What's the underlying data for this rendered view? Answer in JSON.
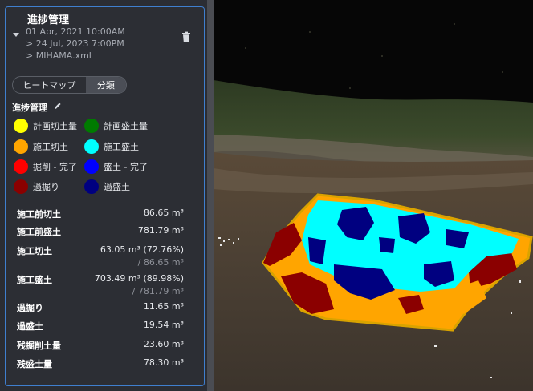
{
  "panel": {
    "title": "進捗管理",
    "meta_start": "01 Apr, 2021 10:00AM",
    "meta_end": "> 24 Jul, 2023 7:00PM",
    "meta_file": "> MIHAMA.xml",
    "collapse_icon": "chevron-down-icon",
    "delete_icon": "trash-icon"
  },
  "tabs": [
    {
      "label": "ヒートマップ",
      "active": false
    },
    {
      "label": "分類",
      "active": true
    }
  ],
  "legend": {
    "title": "進捗管理",
    "edit_icon": "pencil-icon",
    "items": [
      {
        "label": "計画切土量",
        "color": "#ffff00"
      },
      {
        "label": "計画盛土量",
        "color": "#007a00"
      },
      {
        "label": "施工切土",
        "color": "#ffa500"
      },
      {
        "label": "施工盛土",
        "color": "#00ffff"
      },
      {
        "label": "掘削 - 完了",
        "color": "#ff0000"
      },
      {
        "label": "盛土 - 完了",
        "color": "#0000ff"
      },
      {
        "label": "過掘り",
        "color": "#8b0000"
      },
      {
        "label": "過盛土",
        "color": "#000080"
      }
    ]
  },
  "stats": [
    {
      "label": "施工前切土",
      "value": "86.65 m³"
    },
    {
      "label": "施工前盛土",
      "value": "781.79 m³"
    },
    {
      "label": "施工切土",
      "value": "63.05 m³ (72.76%)",
      "sub": "/ 86.65 m³"
    },
    {
      "label": "施工盛土",
      "value": "703.49 m³ (89.98%)",
      "sub": "/ 781.79 m³"
    },
    {
      "label": "過掘り",
      "value": "11.65 m³"
    },
    {
      "label": "過盛土",
      "value": "19.54 m³"
    },
    {
      "label": "残掘削土量",
      "value": "23.60 m³"
    },
    {
      "label": "残盛土量",
      "value": "78.30 m³"
    }
  ],
  "colors": {
    "accent_border": "#3f7fcf",
    "panel_bg": "#2c2e34"
  }
}
